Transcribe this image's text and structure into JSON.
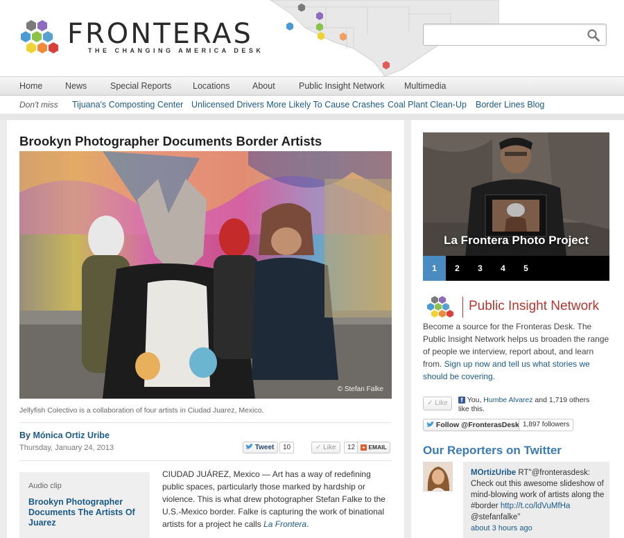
{
  "site": {
    "name": "FRONTERAS",
    "tagline": "THE CHANGING AMERICA DESK"
  },
  "search": {
    "placeholder": "",
    "value": ""
  },
  "nav": {
    "items": [
      "Home",
      "News",
      "Special Reports",
      "Locations",
      "About",
      "Public Insight Network",
      "Multimedia"
    ]
  },
  "subnav": {
    "label": "Don't miss",
    "links": [
      "Tijuana's Composting Center",
      "Unlicensed Drivers More Likely To Cause Crashes",
      "Coal Plant Clean-Up",
      "Border Lines Blog"
    ]
  },
  "article": {
    "headline": "Brookyn Photographer Documents Border Artists",
    "photo_credit": "© Stefan Falke",
    "caption": "Jellyfish Colectivo is a collaboration of four artists in Ciudad Juarez, Mexico.",
    "byline_prefix": "By",
    "author": "Mónica Ortiz Uribe",
    "date": "Thursday, January 24, 2013",
    "share": {
      "tweet_label": "Tweet",
      "tweet_count": "10",
      "like_label": "Like",
      "like_count": "12",
      "email_label": "EMAIL"
    },
    "audio": {
      "label": "Audio clip",
      "title": "Brookyn Photographer Documents The Artists Of Juarez"
    },
    "body_start": "CIUDAD JUÁREZ, Mexico — Art has a way of redefining public spaces, particularly those marked by hardship or violence. This is what drew photographer Stefan Falke to the U.S.-Mexico border. Falke is capturing the work of binational artists for a project he calls ",
    "body_italic": "La Frontera",
    "body_end": "."
  },
  "sidebar": {
    "slideshow": {
      "title": "La Frontera Photo Project",
      "pages": [
        "1",
        "2",
        "3",
        "4",
        "5"
      ],
      "active_page": "1"
    },
    "pin": {
      "name": "Public Insight Network",
      "desc_start": "Become a source for the Fronteras Desk. The Public Insight Network helps us broaden the range of people we interview, report about, and learn from. ",
      "desc_link": "Sign up now and tell us what stories we should be covering."
    },
    "facebook": {
      "like_label": "Like",
      "text_start": "You, ",
      "friend": "Humbe Alvarez",
      "text_end": " and 1,719 others like this."
    },
    "twitter": {
      "follow_label": "Follow @FronterasDesk",
      "followers": "1,897 followers"
    },
    "reporters": {
      "heading": "Our Reporters on Twitter",
      "tweet_user": "MOrtizUribe",
      "tweet_text": " RT\"@fronterasdesk: Check out this awesome slideshow of mind-blowing work of artists along the #border ",
      "tweet_link": "http://t.co/ldVuMfHa",
      "tweet_after": " @stefanfalke\"",
      "tweet_time": "about 3 hours ago"
    }
  },
  "colors": {
    "link": "#1a5a8a",
    "accent_blue": "#4a8cc2",
    "pin_red": "#b4362f",
    "heading_blue": "#3a7ab3"
  }
}
